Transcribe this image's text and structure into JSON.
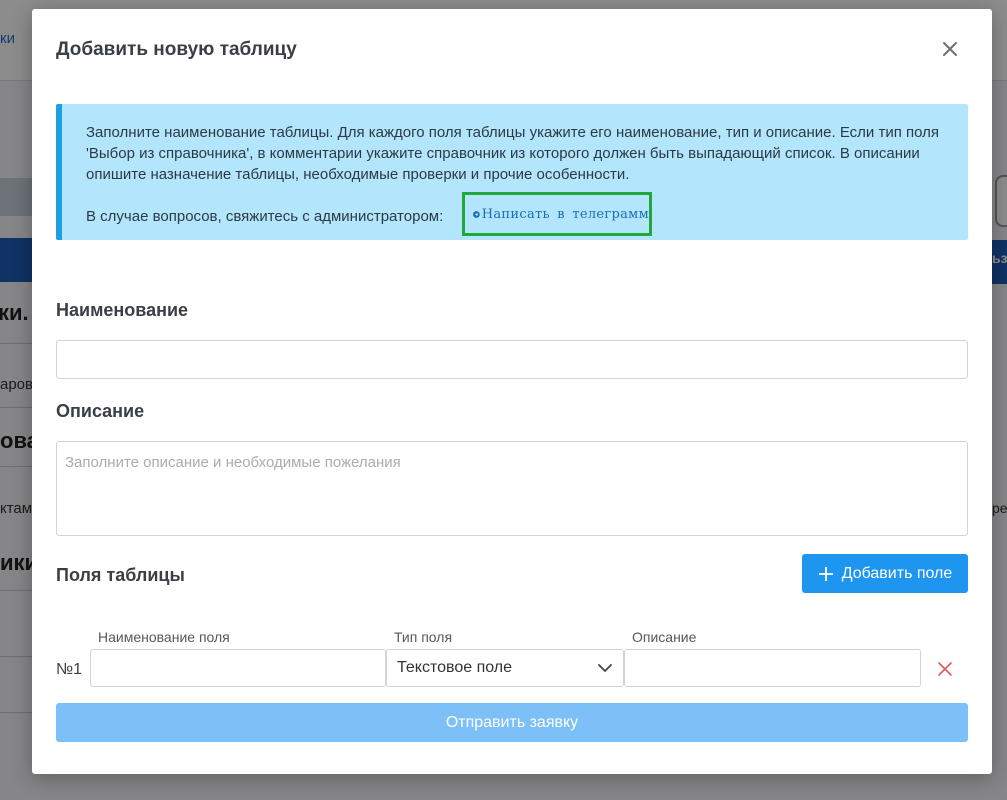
{
  "background": {
    "nav_label": "ки",
    "fragments": [
      "ки. I",
      "аров",
      "ова",
      "ктам",
      "ики"
    ],
    "right_fragments": [
      "ьз",
      "ре"
    ]
  },
  "modal": {
    "title": "Добавить новую таблицу",
    "close_icon": "close-icon",
    "alert": {
      "text": "Заполните наименование таблицы. Для каждого поля таблицы укажите его наименование, тип и описание. Если тип поля 'Выбор из справочника', в комментарии укажите справочник из которого должен быть выпадающий список. В описании опишите назначение таблицы, необходимые проверки и прочие особенности.",
      "contact_text": "В случае вопросов, свяжитесь с администратором:",
      "telegram_link": "Написать в телеграмм",
      "accent_color": "#1e9fe3",
      "background_color": "#b3e5fc"
    },
    "name_section": {
      "label": "Наименование",
      "value": ""
    },
    "description_section": {
      "label": "Описание",
      "placeholder": "Заполните описание и необходимые пожелания",
      "value": ""
    },
    "fields_section": {
      "label": "Поля таблицы",
      "add_button": "Добавить поле",
      "columns": [
        "Наименование поля",
        "Тип поля",
        "Описание"
      ],
      "rows": [
        {
          "number": "№1",
          "name": "",
          "type": "Текстовое поле",
          "description": ""
        }
      ]
    },
    "submit_button": "Отправить заявку",
    "colors": {
      "primary": "#1e96f0",
      "submit_disabled": "#7dc0f7",
      "danger": "#e05a5a",
      "highlight_border": "#22a83a"
    }
  }
}
